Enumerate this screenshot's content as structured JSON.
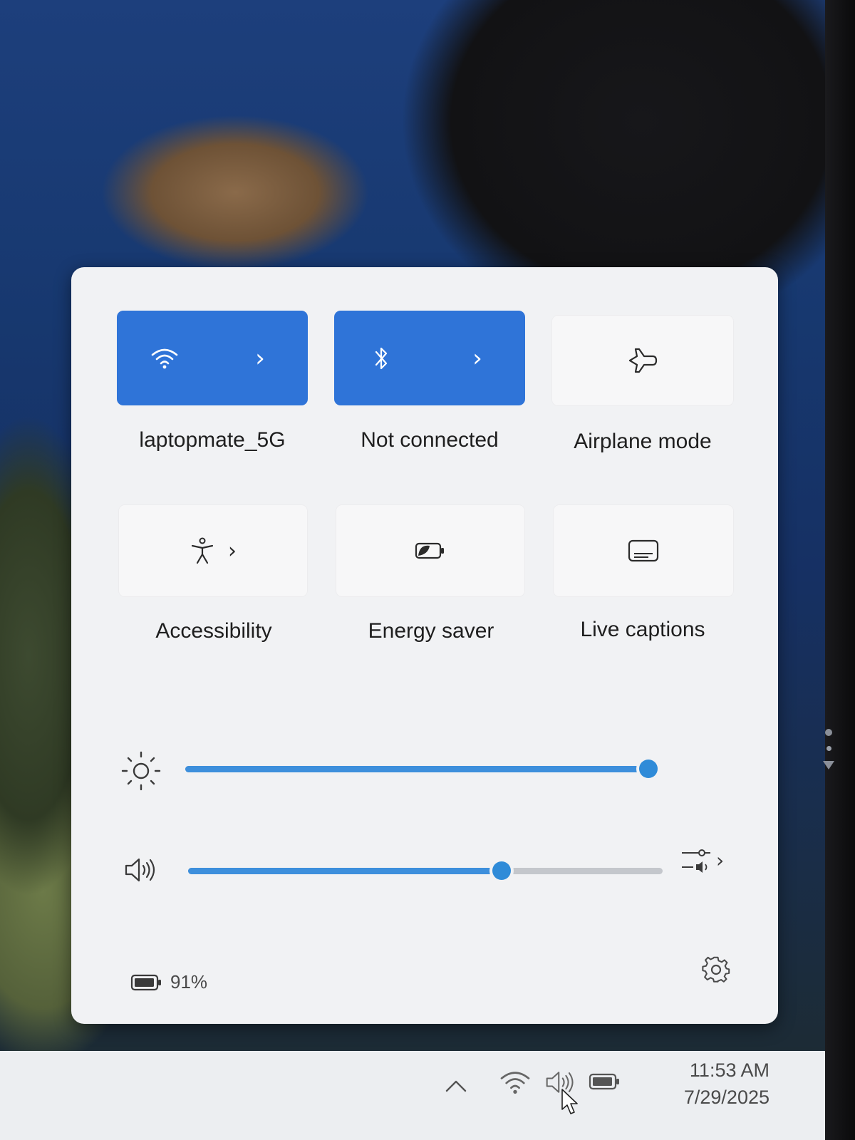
{
  "quick_settings": {
    "tiles": [
      {
        "label": "laptopmate_5G",
        "icon": "wifi-icon",
        "state": "on"
      },
      {
        "label": "Not connected",
        "icon": "bluetooth-icon",
        "state": "on"
      },
      {
        "label": "Airplane mode",
        "icon": "airplane-icon",
        "state": "off"
      },
      {
        "label": "Accessibility",
        "icon": "accessibility-icon",
        "state": "off"
      },
      {
        "label": "Energy saver",
        "icon": "energy-saver-icon",
        "state": "off"
      },
      {
        "label": "Live captions",
        "icon": "captions-icon",
        "state": "off"
      }
    ],
    "brightness": {
      "icon": "brightness-icon",
      "level": 1.0
    },
    "volume": {
      "icon": "volume-icon",
      "level": 0.66
    },
    "battery": {
      "icon": "battery-icon",
      "percent_label": "91%"
    },
    "settings_icon": "gear-icon"
  },
  "taskbar": {
    "time": "11:53 AM",
    "date": "7/29/2025",
    "tray_icons": [
      "chevron-up-icon",
      "wifi-icon",
      "volume-icon",
      "battery-icon"
    ]
  },
  "colors": {
    "accent": "#2f74d8",
    "panel_bg": "#f1f2f4",
    "slider_fill": "#3d8fdc"
  }
}
